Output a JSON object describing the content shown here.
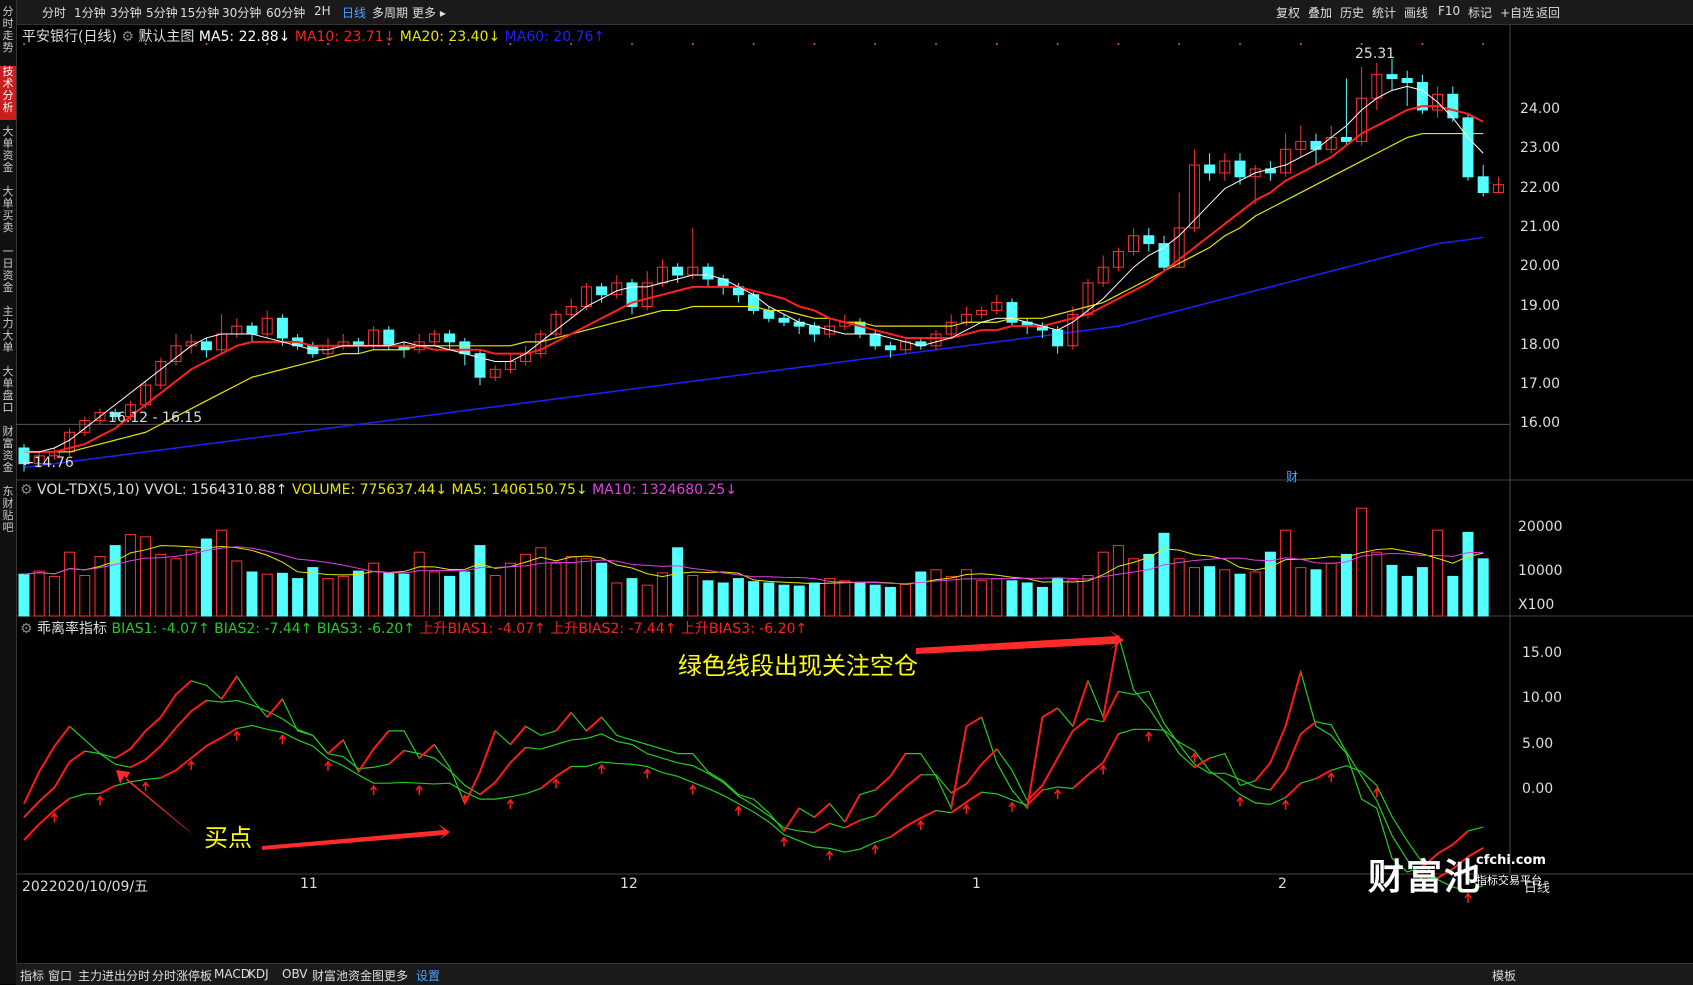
{
  "toolbar": {
    "left": [
      "分时",
      "1分钟",
      "3分钟",
      "5分钟",
      "15分钟",
      "30分钟",
      "60分钟",
      "2H",
      "日线",
      "多周期",
      "更多 ▸"
    ],
    "active": "日线",
    "right": [
      "复权",
      "叠加",
      "历史",
      "统计",
      "画线",
      "F10",
      "标记",
      "+自选",
      "返回"
    ]
  },
  "side_tabs": [
    "分时走势",
    "技术分析",
    "大单资金",
    "大单买卖",
    "一日资金",
    "主力大单",
    "大单盘口",
    "财富资金",
    "东财贴吧"
  ],
  "side_active": "技术分析",
  "main": {
    "title": "平安银行(日线)",
    "template": "默认主图",
    "ma5": "MA5: 22.88↓",
    "ma10": "MA10: 23.71↓",
    "ma20": "MA20: 23.40↓",
    "ma60": "MA60: 20.76↑",
    "high_label": "25.31",
    "low_label": "←14.76",
    "range_label": "16.12 - 16.15",
    "cai": "财",
    "axis": [
      "24.00",
      "23.00",
      "22.00",
      "21.00",
      "20.00",
      "19.00",
      "18.00",
      "17.00",
      "16.00"
    ]
  },
  "vol": {
    "title": "VOL-TDX(5,10) VVOL: 1564310.88↑",
    "volume": "VOLUME: 775637.44↓",
    "ma5": "MA5: 1406150.75↓",
    "ma10": "MA10: 1324680.25↓",
    "axis": [
      "20000",
      "10000",
      "X100"
    ]
  },
  "bias": {
    "title": "乖离率指标",
    "b1": "BIAS1: -4.07↑",
    "b2": "BIAS2: -7.44↑",
    "b3": "BIAS3: -6.20↑",
    "u1": "上升BIAS1: -4.07↑",
    "u2": "上升BIAS2: -7.44↑",
    "u3": "上升BIAS3: -6.20↑",
    "axis": [
      "15.00",
      "10.00",
      "5.00",
      "0.00"
    ],
    "note_top": "绿色线段出现关注空仓",
    "note_buy": "买点"
  },
  "dates": {
    "start": "2022020/10/09/五",
    "months": [
      "11",
      "12",
      "1",
      "2"
    ],
    "end": "日线"
  },
  "bottom": [
    "指标",
    "窗口",
    "主力进出分时",
    "分时涨停板",
    "MACD",
    "KDJ",
    "OBV",
    "财富池资金图",
    "更多",
    "设置"
  ],
  "bottom_active": "设置",
  "bottom_right": "模板",
  "brand": {
    "logo": "财富池",
    "site": "cfchi.com",
    "sub": "指标交易平台"
  },
  "colors": {
    "up": "#ff3232",
    "down": "#54ffff",
    "ma5": "#ffffff",
    "ma10": "#ff2020",
    "ma20": "#e6e600",
    "ma60": "#2020ff",
    "green": "#22cc22"
  },
  "chart_data": {
    "type": "candlestick",
    "candles": [
      [
        15.4,
        15.0,
        15.5,
        14.8
      ],
      [
        15.0,
        15.2,
        15.3,
        14.9
      ],
      [
        15.2,
        15.3,
        15.4,
        15.1
      ],
      [
        15.3,
        15.8,
        15.9,
        15.2
      ],
      [
        15.8,
        16.1,
        16.2,
        15.7
      ],
      [
        16.1,
        16.3,
        16.4,
        16.0
      ],
      [
        16.3,
        16.2,
        16.4,
        16.1
      ],
      [
        16.2,
        16.5,
        16.6,
        16.1
      ],
      [
        16.5,
        17.0,
        17.1,
        16.4
      ],
      [
        17.0,
        17.6,
        17.7,
        16.9
      ],
      [
        17.6,
        18.0,
        18.3,
        17.5
      ],
      [
        18.0,
        18.1,
        18.3,
        17.8
      ],
      [
        18.1,
        17.9,
        18.2,
        17.7
      ],
      [
        17.9,
        18.3,
        18.8,
        17.8
      ],
      [
        18.3,
        18.5,
        18.7,
        18.2
      ],
      [
        18.5,
        18.3,
        18.6,
        18.1
      ],
      [
        18.3,
        18.7,
        18.9,
        18.2
      ],
      [
        18.7,
        18.2,
        18.8,
        18.0
      ],
      [
        18.2,
        18.0,
        18.3,
        17.9
      ],
      [
        18.0,
        17.8,
        18.1,
        17.7
      ],
      [
        17.8,
        18.0,
        18.2,
        17.7
      ],
      [
        18.0,
        18.1,
        18.3,
        17.9
      ],
      [
        18.1,
        18.0,
        18.2,
        17.8
      ],
      [
        18.0,
        18.4,
        18.5,
        17.9
      ],
      [
        18.4,
        18.0,
        18.5,
        17.9
      ],
      [
        18.0,
        17.9,
        18.1,
        17.7
      ],
      [
        17.9,
        18.1,
        18.3,
        17.8
      ],
      [
        18.1,
        18.3,
        18.4,
        18.0
      ],
      [
        18.3,
        18.1,
        18.4,
        17.9
      ],
      [
        18.1,
        17.8,
        18.2,
        17.5
      ],
      [
        17.8,
        17.2,
        17.9,
        17.0
      ],
      [
        17.2,
        17.4,
        17.5,
        17.1
      ],
      [
        17.4,
        17.6,
        17.8,
        17.3
      ],
      [
        17.6,
        17.8,
        18.0,
        17.5
      ],
      [
        17.8,
        18.3,
        18.4,
        17.7
      ],
      [
        18.3,
        18.8,
        18.9,
        18.2
      ],
      [
        18.8,
        19.0,
        19.2,
        18.7
      ],
      [
        19.0,
        19.5,
        19.6,
        18.9
      ],
      [
        19.5,
        19.3,
        19.6,
        19.1
      ],
      [
        19.3,
        19.6,
        19.8,
        19.2
      ],
      [
        19.6,
        19.0,
        19.7,
        18.8
      ],
      [
        19.0,
        19.6,
        19.9,
        18.9
      ],
      [
        19.6,
        20.0,
        20.2,
        19.5
      ],
      [
        20.0,
        19.8,
        20.1,
        19.6
      ],
      [
        19.8,
        20.0,
        21.0,
        19.7
      ],
      [
        20.0,
        19.7,
        20.1,
        19.5
      ],
      [
        19.7,
        19.5,
        19.8,
        19.3
      ],
      [
        19.5,
        19.3,
        19.6,
        19.1
      ],
      [
        19.3,
        18.9,
        19.4,
        18.8
      ],
      [
        18.9,
        18.7,
        19.0,
        18.6
      ],
      [
        18.7,
        18.6,
        18.8,
        18.5
      ],
      [
        18.6,
        18.5,
        18.7,
        18.3
      ],
      [
        18.5,
        18.3,
        18.6,
        18.1
      ],
      [
        18.3,
        18.5,
        18.7,
        18.2
      ],
      [
        18.5,
        18.6,
        18.8,
        18.4
      ],
      [
        18.6,
        18.3,
        18.7,
        18.2
      ],
      [
        18.3,
        18.0,
        18.4,
        17.9
      ],
      [
        18.0,
        17.9,
        18.1,
        17.7
      ],
      [
        17.9,
        18.1,
        18.2,
        17.8
      ],
      [
        18.1,
        18.0,
        18.2,
        17.9
      ],
      [
        18.0,
        18.3,
        18.4,
        17.9
      ],
      [
        18.3,
        18.6,
        18.8,
        18.2
      ],
      [
        18.6,
        18.8,
        19.0,
        18.5
      ],
      [
        18.8,
        18.9,
        19.0,
        18.7
      ],
      [
        18.9,
        19.1,
        19.3,
        18.8
      ],
      [
        19.1,
        18.6,
        19.2,
        18.5
      ],
      [
        18.6,
        18.5,
        18.7,
        18.3
      ],
      [
        18.5,
        18.4,
        18.6,
        18.2
      ],
      [
        18.4,
        18.0,
        18.5,
        17.8
      ],
      [
        18.0,
        18.8,
        19.0,
        17.9
      ],
      [
        18.8,
        19.6,
        19.7,
        18.7
      ],
      [
        19.6,
        20.0,
        20.3,
        19.5
      ],
      [
        20.0,
        20.4,
        20.5,
        19.9
      ],
      [
        20.4,
        20.8,
        21.0,
        20.3
      ],
      [
        20.8,
        20.6,
        21.0,
        20.4
      ],
      [
        20.6,
        20.0,
        20.8,
        19.9
      ],
      [
        20.0,
        21.0,
        21.9,
        20.0
      ],
      [
        21.0,
        22.6,
        23.0,
        20.9
      ],
      [
        22.6,
        22.4,
        22.9,
        22.2
      ],
      [
        22.4,
        22.7,
        22.9,
        22.2
      ],
      [
        22.7,
        22.3,
        22.9,
        22.1
      ],
      [
        22.3,
        22.5,
        22.6,
        21.6
      ],
      [
        22.5,
        22.4,
        22.7,
        22.2
      ],
      [
        22.4,
        23.0,
        23.4,
        22.3
      ],
      [
        23.0,
        23.2,
        23.6,
        22.8
      ],
      [
        23.2,
        23.0,
        23.4,
        22.6
      ],
      [
        23.0,
        23.3,
        23.6,
        22.9
      ],
      [
        23.3,
        23.2,
        24.8,
        23.1
      ],
      [
        23.2,
        24.3,
        25.1,
        23.1
      ],
      [
        24.3,
        24.9,
        25.2,
        24.0
      ],
      [
        24.9,
        24.8,
        25.3,
        24.5
      ],
      [
        24.8,
        24.7,
        25.0,
        24.1
      ],
      [
        24.7,
        24.0,
        24.9,
        23.9
      ],
      [
        24.0,
        24.4,
        24.6,
        23.8
      ],
      [
        24.4,
        23.8,
        24.6,
        23.7
      ],
      [
        23.8,
        22.3,
        23.9,
        22.2
      ],
      [
        22.3,
        21.9,
        22.6,
        21.8
      ],
      [
        21.9,
        22.1,
        22.3,
        21.9
      ]
    ],
    "ma5": [
      15.3,
      15.3,
      15.4,
      15.6,
      15.9,
      16.2,
      16.5,
      16.8,
      17.1,
      17.4,
      17.7,
      18.0,
      18.2,
      18.3,
      18.3,
      18.3,
      18.2,
      18.1,
      18.0,
      17.9,
      17.9,
      18.0,
      18.0,
      18.0,
      18.0,
      18.1,
      18.0,
      18.0,
      17.9,
      17.8,
      17.7,
      17.6,
      17.6,
      17.8,
      18.1,
      18.4,
      18.7,
      19.0,
      19.2,
      19.4,
      19.5,
      19.5,
      19.6,
      19.7,
      19.8,
      19.8,
      19.7,
      19.5,
      19.3,
      19.0,
      18.8,
      18.6,
      18.5,
      18.4,
      18.3,
      18.3,
      18.3,
      18.2,
      18.1,
      18.0,
      18.1,
      18.2,
      18.4,
      18.6,
      18.7,
      18.7,
      18.6,
      18.5,
      18.4,
      18.6,
      18.9,
      19.2,
      19.6,
      20.0,
      20.3,
      20.5,
      20.8,
      21.2,
      21.6,
      22.0,
      22.2,
      22.4,
      22.5,
      22.6,
      22.8,
      23.0,
      23.3,
      23.6,
      24.0,
      24.3,
      24.5,
      24.6,
      24.5,
      24.2,
      23.8,
      23.3,
      22.9
    ],
    "ma10": [
      15.3,
      15.3,
      15.3,
      15.4,
      15.5,
      15.7,
      15.9,
      16.2,
      16.5,
      16.8,
      17.1,
      17.4,
      17.6,
      17.8,
      18.0,
      18.1,
      18.1,
      18.1,
      18.1,
      18.0,
      18.0,
      18.0,
      18.0,
      18.0,
      18.0,
      18.0,
      18.0,
      17.9,
      17.9,
      17.9,
      17.9,
      17.8,
      17.8,
      17.8,
      17.9,
      18.1,
      18.3,
      18.5,
      18.7,
      18.9,
      19.1,
      19.2,
      19.3,
      19.4,
      19.5,
      19.5,
      19.5,
      19.5,
      19.4,
      19.3,
      19.2,
      19.0,
      18.9,
      18.7,
      18.6,
      18.5,
      18.4,
      18.3,
      18.2,
      18.2,
      18.2,
      18.2,
      18.3,
      18.4,
      18.4,
      18.5,
      18.5,
      18.5,
      18.6,
      18.7,
      18.8,
      19.0,
      19.2,
      19.4,
      19.6,
      19.9,
      20.2,
      20.5,
      20.8,
      21.1,
      21.4,
      21.7,
      21.9,
      22.2,
      22.4,
      22.6,
      22.8,
      23.1,
      23.4,
      23.6,
      23.8,
      24.0,
      24.1,
      24.1,
      24.0,
      23.9,
      23.7
    ],
    "ma20": [
      15.3,
      15.3,
      15.3,
      15.3,
      15.4,
      15.5,
      15.6,
      15.7,
      15.8,
      16.0,
      16.2,
      16.4,
      16.6,
      16.8,
      17.0,
      17.2,
      17.3,
      17.4,
      17.5,
      17.6,
      17.7,
      17.8,
      17.8,
      17.9,
      17.9,
      17.9,
      18.0,
      18.0,
      18.0,
      18.0,
      18.0,
      18.0,
      18.0,
      18.1,
      18.1,
      18.2,
      18.3,
      18.4,
      18.5,
      18.6,
      18.7,
      18.8,
      18.9,
      18.9,
      19.0,
      19.0,
      19.0,
      19.0,
      19.0,
      18.9,
      18.9,
      18.8,
      18.7,
      18.7,
      18.6,
      18.6,
      18.5,
      18.5,
      18.5,
      18.5,
      18.5,
      18.5,
      18.6,
      18.6,
      18.6,
      18.7,
      18.7,
      18.7,
      18.8,
      18.9,
      19.0,
      19.1,
      19.3,
      19.5,
      19.7,
      19.9,
      20.1,
      20.3,
      20.5,
      20.8,
      21.0,
      21.3,
      21.5,
      21.7,
      21.9,
      22.1,
      22.3,
      22.5,
      22.7,
      22.9,
      23.1,
      23.3,
      23.4,
      23.4,
      23.4,
      23.4,
      23.4
    ],
    "ma60": [
      14.9,
      14.95,
      15.0,
      15.05,
      15.1,
      15.15,
      15.2,
      15.25,
      15.3,
      15.35,
      15.4,
      15.45,
      15.5,
      15.55,
      15.6,
      15.65,
      15.7,
      15.75,
      15.8,
      15.85,
      15.9,
      15.95,
      16.0,
      16.05,
      16.1,
      16.15,
      16.2,
      16.25,
      16.3,
      16.35,
      16.4,
      16.45,
      16.5,
      16.55,
      16.6,
      16.65,
      16.7,
      16.75,
      16.8,
      16.85,
      16.9,
      16.95,
      17.0,
      17.05,
      17.1,
      17.15,
      17.2,
      17.25,
      17.3,
      17.35,
      17.4,
      17.45,
      17.5,
      17.55,
      17.6,
      17.65,
      17.7,
      17.75,
      17.8,
      17.85,
      17.9,
      17.95,
      18.0,
      18.05,
      18.1,
      18.15,
      18.2,
      18.25,
      18.3,
      18.35,
      18.4,
      18.45,
      18.5,
      18.6,
      18.7,
      18.8,
      18.9,
      19.0,
      19.1,
      19.2,
      19.3,
      19.4,
      19.5,
      19.6,
      19.7,
      19.8,
      19.9,
      20.0,
      20.1,
      20.2,
      20.3,
      20.4,
      20.5,
      20.6,
      20.65,
      20.7,
      20.76
    ],
    "volume": [
      9500,
      10200,
      9000,
      14500,
      9200,
      13500,
      16000,
      18500,
      18000,
      14000,
      13000,
      15000,
      17500,
      19500,
      12500,
      10000,
      9500,
      9700,
      8500,
      11000,
      8500,
      9000,
      10200,
      12000,
      9800,
      9500,
      14500,
      10000,
      9000,
      10000,
      16000,
      9200,
      12000,
      14000,
      15500,
      12000,
      13500,
      13000,
      12000,
      7500,
      8500,
      7000,
      9800,
      15500,
      9200,
      8000,
      7500,
      8500,
      7800,
      7500,
      7000,
      6800,
      7500,
      8500,
      8000,
      7500,
      7000,
      6500,
      7200,
      10000,
      10500,
      9000,
      10500,
      8000,
      8500,
      8000,
      7500,
      6500,
      8500,
      8200,
      9200,
      14500,
      16000,
      13000,
      14000,
      18800,
      13000,
      11000,
      11200,
      10500,
      9500,
      10000,
      14500,
      19500,
      11000,
      10500,
      12000,
      14000,
      24500,
      14500,
      11500,
      9000,
      11000,
      19500,
      9000,
      19000,
      13000
    ],
    "bias1": [
      -1.5,
      2.0,
      4.8,
      7.0,
      5.5,
      4.0,
      3.5,
      4.5,
      6.5,
      8.0,
      10.5,
      12.0,
      11.5,
      10.0,
      12.5,
      10.0,
      8.0,
      10.0,
      6.5,
      6.0,
      4.0,
      5.5,
      2.0,
      4.5,
      6.5,
      6.5,
      3.5,
      5.0,
      2.5,
      -1.5,
      2.0,
      6.5,
      5.0,
      7.0,
      6.0,
      6.5,
      8.5,
      6.5,
      8.0,
      6.0,
      5.5,
      5.0,
      4.5,
      4.0,
      4.0,
      2.0,
      1.0,
      -0.5,
      -1.0,
      -2.5,
      -4.5,
      -2.0,
      -3.0,
      -1.5,
      -3.5,
      -0.5,
      0.0,
      1.5,
      4.0,
      4.0,
      1.5,
      -2.0,
      7.0,
      8.0,
      3.0,
      0.0,
      -2.0,
      8.0,
      9.0,
      7.0,
      12.0,
      8.0,
      17.0,
      11.0,
      9.0,
      6.5,
      4.0,
      2.5,
      3.5,
      4.0,
      0.5,
      1.0,
      3.0,
      7.0,
      13.0,
      7.0,
      6.0,
      4.0,
      -1.0,
      -2.0,
      -7.5,
      -9.0,
      -8.5,
      -7.0,
      -6.0,
      -4.5,
      -4.07
    ]
  }
}
